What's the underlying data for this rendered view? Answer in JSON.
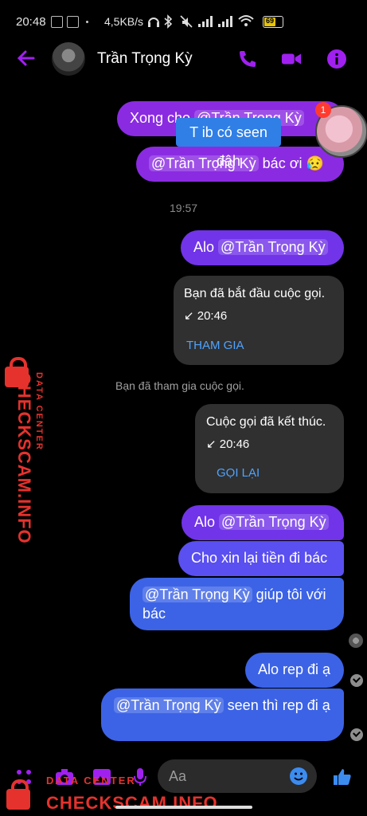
{
  "status_bar": {
    "time": "20:48",
    "network_speed": "4,5KB/s",
    "battery": "69",
    "icons": [
      "notification-icon",
      "app-icon",
      "headphones-icon",
      "bluetooth-icon",
      "mute-icon",
      "signal-icon",
      "signal-icon",
      "wifi-icon",
      "battery-icon"
    ]
  },
  "header": {
    "contact_name": "Trần Trọng Kỳ",
    "accent_color": "#a020f0"
  },
  "overlay": {
    "tooltip_text": "T ib có seen đâh",
    "badge_count": "1"
  },
  "messages": {
    "m1_prefix": "Xong cho",
    "m1_mention": "@Trần Trọng Kỳ",
    "m2_mention": "@Trần Trọng Kỳ",
    "m2_text": "bác ơi 😥",
    "time_1": "19:57",
    "m3_text": "Alo",
    "m3_mention": "@Trần Trọng Kỳ",
    "call1_title": "Bạn đã bắt đầu cuộc gọi.",
    "call1_time": "↙ 20:46",
    "call1_action": "THAM GIA",
    "system_note": "Bạn đã tham gia cuộc gọi.",
    "call2_title": "Cuộc gọi đã kết thúc.",
    "call2_time": "↙ 20:46",
    "call2_action": "GỌI LẠI",
    "m4_text": "Alo",
    "m4_mention": "@Trần Trọng Kỳ",
    "m5_text": "Cho xin lại tiền đi bác",
    "m6_mention": "@Trần Trọng Kỳ",
    "m6_text": "giúp tôi với bác",
    "m7_text": "Alo rep đi ạ",
    "m8_mention": "@Trần Trọng Kỳ",
    "m8_text": "seen thì rep đi ạ"
  },
  "composer": {
    "placeholder": "Aa"
  },
  "watermark": {
    "side_big": "CHECKSCAM.INFO",
    "side_small": "DATA CENTER",
    "bottom_big": "CHECKSCAM.INFO",
    "bottom_small": "DATA CENTER",
    "color": "#e5322d"
  }
}
